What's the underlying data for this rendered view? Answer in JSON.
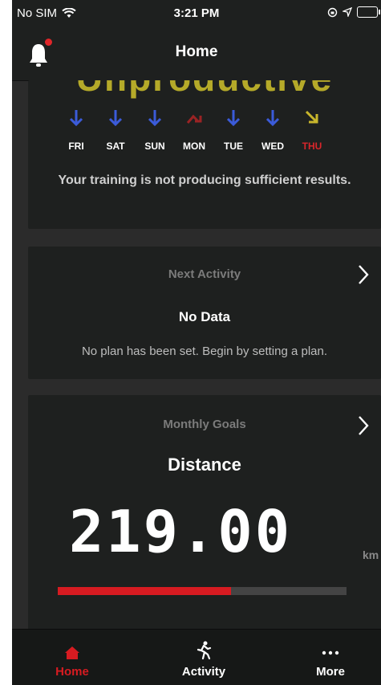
{
  "status_bar": {
    "carrier": "No SIM",
    "time": "3:21 PM"
  },
  "nav": {
    "title": "Home"
  },
  "training": {
    "status": "Unproductive",
    "days": [
      {
        "label": "FRI",
        "trend": "down",
        "color": "#3b5bd9",
        "label_color": "#ffffff"
      },
      {
        "label": "SAT",
        "trend": "down",
        "color": "#3b5bd9",
        "label_color": "#ffffff"
      },
      {
        "label": "SUN",
        "trend": "down",
        "color": "#3b5bd9",
        "label_color": "#ffffff"
      },
      {
        "label": "MON",
        "trend": "peak",
        "color": "#9b2324",
        "label_color": "#ffffff"
      },
      {
        "label": "TUE",
        "trend": "down",
        "color": "#3b5bd9",
        "label_color": "#ffffff"
      },
      {
        "label": "WED",
        "trend": "down",
        "color": "#3b5bd9",
        "label_color": "#ffffff"
      },
      {
        "label": "THU",
        "trend": "down-right",
        "color": "#c8b62c",
        "label_color": "#d9262b"
      }
    ],
    "message": "Your training is not producing sufficient results."
  },
  "next_activity": {
    "heading": "Next Activity",
    "value": "No Data",
    "note": "No plan has been set. Begin by setting a plan."
  },
  "monthly_goals": {
    "heading": "Monthly Goals",
    "metric": "Distance",
    "value": "219.00",
    "unit": "km",
    "progress_fraction": 0.6
  },
  "tabs": [
    {
      "label": "Home",
      "icon": "home-icon",
      "active": true
    },
    {
      "label": "Activity",
      "icon": "runner-icon",
      "active": false
    },
    {
      "label": "More",
      "icon": "more-icon",
      "active": false
    }
  ],
  "colors": {
    "accent": "#d71b21",
    "card": "#1e201f",
    "background": "#2b2b2b"
  }
}
